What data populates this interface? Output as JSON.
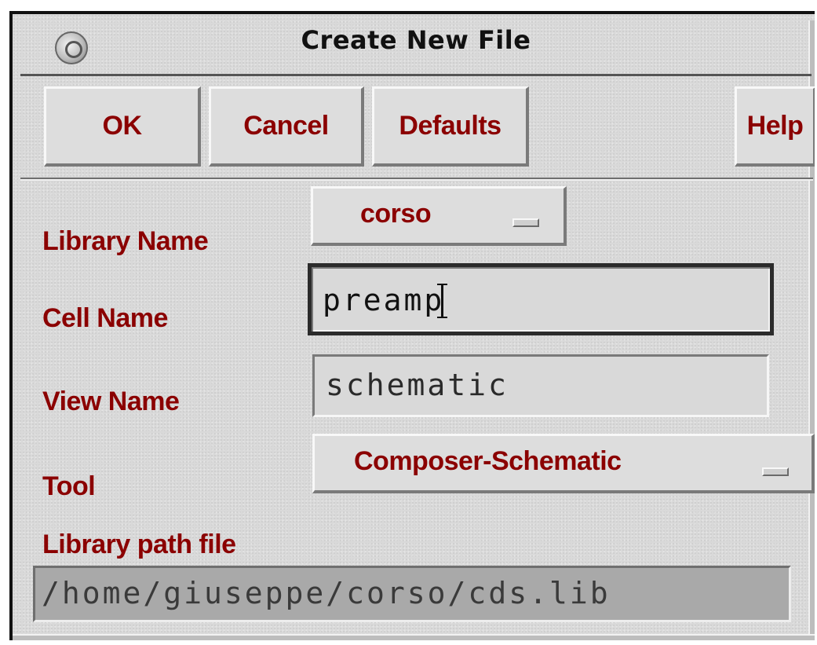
{
  "window": {
    "title": "Create New File",
    "icon": "globe-icon"
  },
  "toolbar": {
    "ok_label": "OK",
    "cancel_label": "Cancel",
    "defaults_label": "Defaults",
    "help_label": "Help"
  },
  "form": {
    "library_name_label": "Library Name",
    "library_name_value": "corso",
    "cell_name_label": "Cell Name",
    "cell_name_value": "preamp",
    "view_name_label": "View Name",
    "view_name_value": "schematic",
    "tool_label": "Tool",
    "tool_value": "Composer-Schematic",
    "library_path_label": "Library path file",
    "library_path_value": "/home/giuseppe/corso/cds.lib"
  },
  "colors": {
    "label_text": "#8b0000",
    "panel_bg": "#d9d9d9",
    "path_field_bg": "#a9a9a9"
  }
}
